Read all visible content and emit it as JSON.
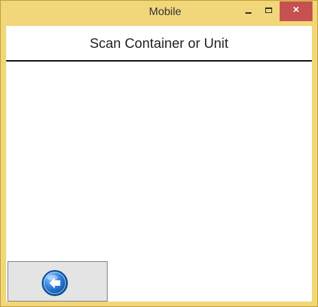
{
  "window": {
    "title": "Mobile",
    "controls": {
      "minimize_icon": "minimize-icon",
      "maximize_icon": "maximize-icon",
      "close_icon": "close-icon",
      "close_glyph": "×"
    }
  },
  "screen": {
    "title": "Scan Container or Unit"
  },
  "footer": {
    "back_icon": "back-arrow-icon"
  },
  "colors": {
    "window_frame": "#f1d77a",
    "close_button": "#c75050",
    "button_face": "#e4e4e4",
    "icon_blue": "#2f7fdb"
  }
}
